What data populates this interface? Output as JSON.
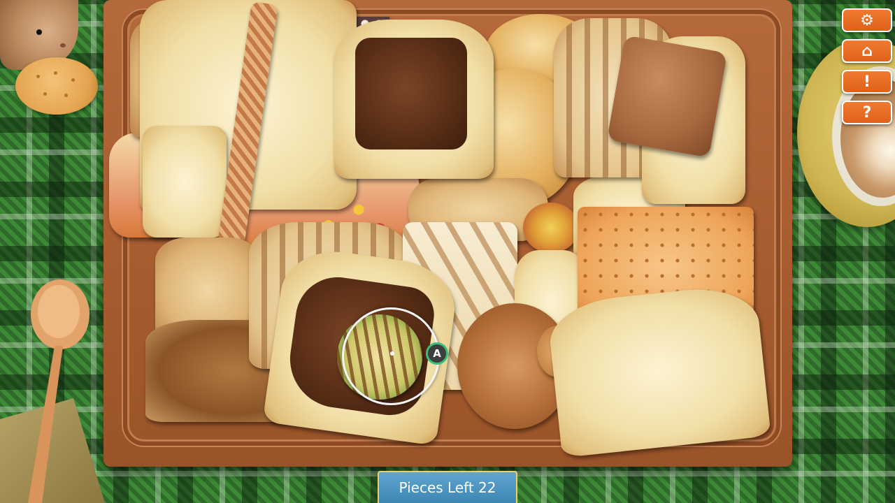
{
  "hud": {
    "pieces_left_label": "Pieces Left",
    "pieces_left_count": "22"
  },
  "side_menu": [
    {
      "name": "settings",
      "icon": "gear-icon",
      "glyph": "⚙"
    },
    {
      "name": "home",
      "icon": "home-icon",
      "glyph": "⌂"
    },
    {
      "name": "hint",
      "icon": "exclamation-icon",
      "glyph": "!"
    },
    {
      "name": "help",
      "icon": "question-icon",
      "glyph": "?"
    }
  ],
  "cursor": {
    "button_glyph": "A"
  },
  "colors": {
    "accent_orange": "#e0601a",
    "banner_blue": "#4a93c0",
    "board_wood": "#a95e31",
    "cursor_green": "#3ac07a"
  }
}
